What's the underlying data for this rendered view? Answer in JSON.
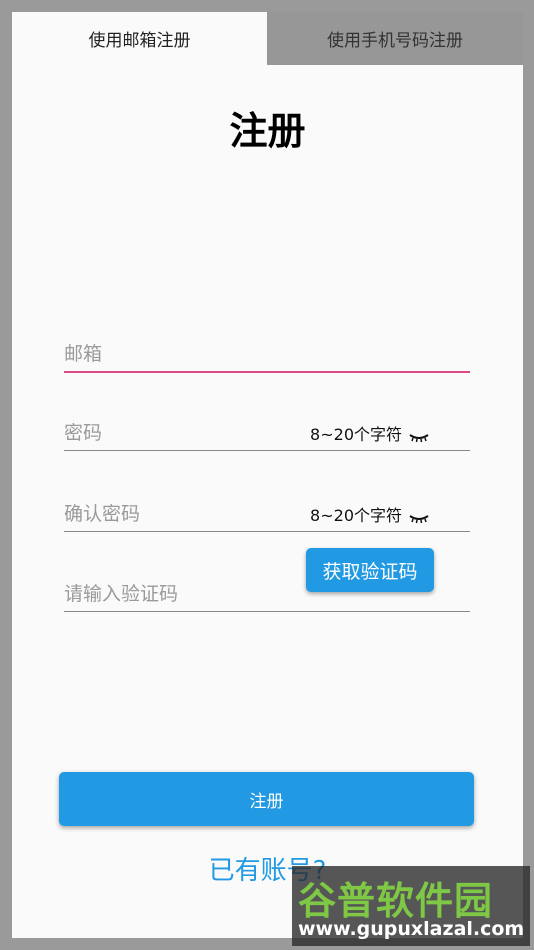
{
  "tabs": [
    {
      "label": "使用邮箱注册",
      "active": true
    },
    {
      "label": "使用手机号码注册",
      "active": false
    }
  ],
  "page_title": "注册",
  "form": {
    "email": {
      "placeholder": "邮箱",
      "value": ""
    },
    "password": {
      "placeholder": "密码",
      "value": "",
      "hint": "8~20个字符",
      "icon": "eye-closed-icon"
    },
    "confirm_password": {
      "placeholder": "确认密码",
      "value": "",
      "hint": "8~20个字符",
      "icon": "eye-closed-icon"
    },
    "code": {
      "placeholder": "请输入验证码",
      "value": ""
    },
    "get_code_label": "获取验证码"
  },
  "submit_label": "注册",
  "login_link": "已有账号?",
  "watermark": {
    "title": "谷普软件园",
    "url": "www.gupuxlazal.com"
  },
  "colors": {
    "accent": "#2199e3",
    "focus_underline": "#d94a86",
    "inactive_tab": "#979797"
  }
}
